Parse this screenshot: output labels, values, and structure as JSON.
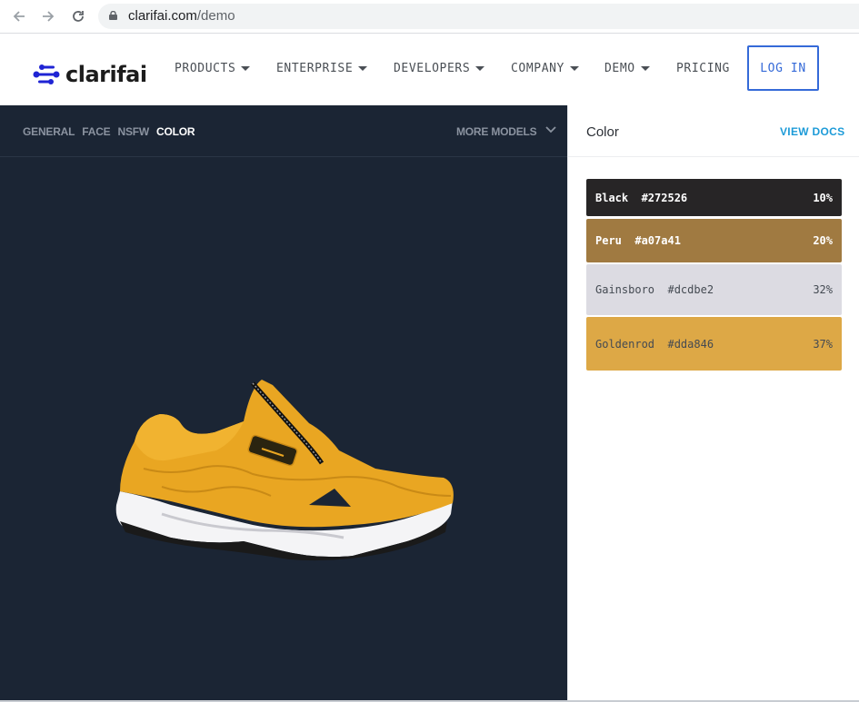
{
  "browser": {
    "url_domain": "clarifai.com",
    "url_path": "/demo"
  },
  "site": {
    "logo_text": "clarifai",
    "nav": [
      {
        "label": "PRODUCTS",
        "dropdown": true
      },
      {
        "label": "ENTERPRISE",
        "dropdown": true
      },
      {
        "label": "DEVELOPERS",
        "dropdown": true
      },
      {
        "label": "COMPANY",
        "dropdown": true
      },
      {
        "label": "DEMO",
        "dropdown": true
      },
      {
        "label": "PRICING",
        "dropdown": false
      }
    ],
    "login_label": "LOG IN"
  },
  "model_bar": {
    "tabs": [
      "GENERAL",
      "FACE",
      "NSFW",
      "COLOR"
    ],
    "active_tab": "COLOR",
    "more_models": "MORE MODELS"
  },
  "panel": {
    "title": "Color",
    "view_docs": "VIEW DOCS",
    "colors": [
      {
        "name": "Black",
        "hex": "#272526",
        "percent": "10%",
        "text_style": "dark"
      },
      {
        "name": "Peru",
        "hex": "#a07a41",
        "percent": "20%",
        "text_style": "dark"
      },
      {
        "name": "Gainsboro",
        "hex": "#dcdbe2",
        "percent": "32%",
        "text_style": "light"
      },
      {
        "name": "Goldenrod",
        "hex": "#dda846",
        "percent": "37%",
        "text_style": "light"
      }
    ]
  },
  "colors": {
    "brand_blue": "#356ad8",
    "link_blue": "#1d9bd8",
    "dark_panel": "#1b2534"
  }
}
